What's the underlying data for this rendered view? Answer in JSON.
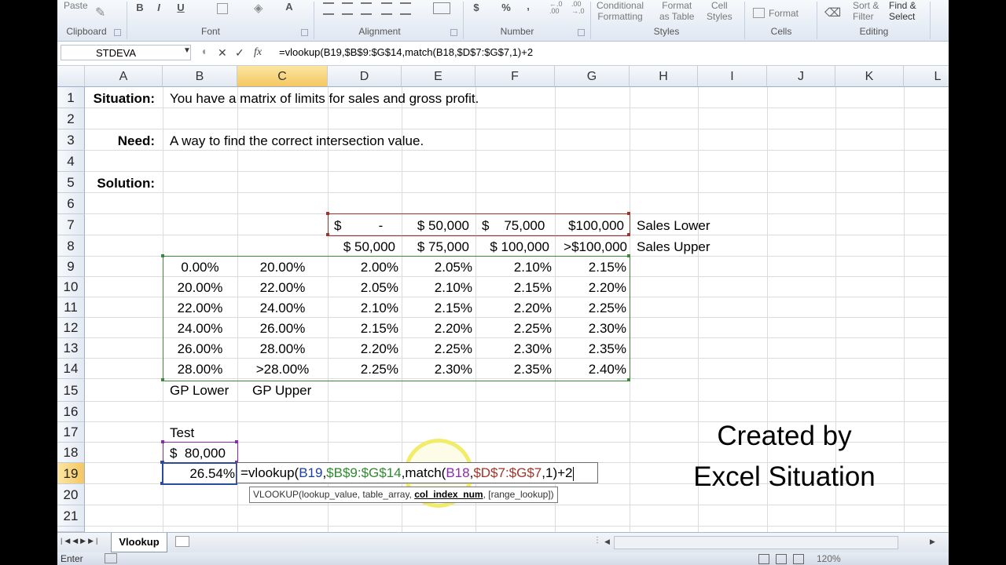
{
  "ribbon": {
    "paste": "Paste",
    "clipboard": "Clipboard",
    "font": "Font",
    "alignment": "Alignment",
    "number": "Number",
    "styles": "Styles",
    "cells": "Cells",
    "editing": "Editing",
    "bold": "B",
    "italic": "I",
    "underline": "U",
    "font_color_letter": "A",
    "currency": "$",
    "percent": "%",
    "comma": ",",
    "conditional_formatting_1": "Conditional",
    "conditional_formatting_2": "Formatting",
    "format_as_table_1": "Format",
    "format_as_table_2": "as Table",
    "cell_styles_1": "Cell",
    "cell_styles_2": "Styles",
    "format": "Format",
    "sort_filter_1": "Sort &",
    "sort_filter_2": "Filter",
    "find_select_1": "Find &",
    "find_select_2": "Select"
  },
  "formula_bar": {
    "name_box": "STDEVA",
    "cancel_glyph": "✕",
    "enter_glyph": "✓",
    "fx": "fx",
    "formula": "=vlookup(B19,$B$9:$G$14,match(B18,$D$7:$G$7,1)+2"
  },
  "columns": [
    "A",
    "B",
    "C",
    "D",
    "E",
    "F",
    "G",
    "H",
    "I",
    "J",
    "K",
    "L"
  ],
  "rows": [
    "1",
    "2",
    "3",
    "4",
    "5",
    "6",
    "7",
    "8",
    "9",
    "10",
    "11",
    "12",
    "13",
    "14",
    "15",
    "16",
    "17",
    "18",
    "19",
    "20",
    "21"
  ],
  "labels": {
    "situation": "Situation:",
    "situation_text": "You have a matrix of limits for sales and gross profit.",
    "need": "Need:",
    "need_text": "A way to find the correct intersection value.",
    "solution": "Solution:",
    "sales_lower": "Sales Lower",
    "sales_upper": "Sales Upper",
    "gp_lower": "GP Lower",
    "gp_upper": "GP Upper",
    "test": "Test"
  },
  "sales_lower_row": [
    "$          -",
    "$  50,000",
    "$    75,000",
    "$100,000"
  ],
  "sales_upper_row": [
    "$  50,000",
    "$  75,000",
    "$ 100,000",
    ">$100,000"
  ],
  "matrix": [
    [
      "0.00%",
      "20.00%",
      "2.00%",
      "2.05%",
      "2.10%",
      "2.15%"
    ],
    [
      "20.00%",
      "22.00%",
      "2.05%",
      "2.10%",
      "2.15%",
      "2.20%"
    ],
    [
      "22.00%",
      "24.00%",
      "2.10%",
      "2.15%",
      "2.20%",
      "2.25%"
    ],
    [
      "24.00%",
      "26.00%",
      "2.15%",
      "2.20%",
      "2.25%",
      "2.30%"
    ],
    [
      "26.00%",
      "28.00%",
      "2.20%",
      "2.25%",
      "2.30%",
      "2.35%"
    ],
    [
      "28.00%",
      ">28.00%",
      "2.25%",
      "2.30%",
      "2.35%",
      "2.40%"
    ]
  ],
  "test": {
    "sales": "$  80,000",
    "gp": "26.54%"
  },
  "edit_formula": {
    "p1": "=vlookup(",
    "p2": "B19",
    "p3": ",",
    "p4": "$B$9:$G$14",
    "p5": ",match(",
    "p6": "B18",
    "p7": ",",
    "p8": "$D$7:$G$7",
    "p9": ",1)+2"
  },
  "tooltip": {
    "t1": "VLOOKUP(lookup_value, table_array, ",
    "t2": "col_index_num",
    "t3": ", [range_lookup])"
  },
  "watermark": {
    "line1": "Created by",
    "line2": "Excel Situation"
  },
  "sheet_tab": "Vlookup",
  "status": "Enter",
  "zoom": "120%",
  "colors": {
    "ref_blue": "#1a3fa8",
    "ref_green": "#2f8a2f",
    "ref_purple": "#8a2ab0",
    "ref_red": "#a0342a",
    "selection_header": "#f5c760"
  }
}
